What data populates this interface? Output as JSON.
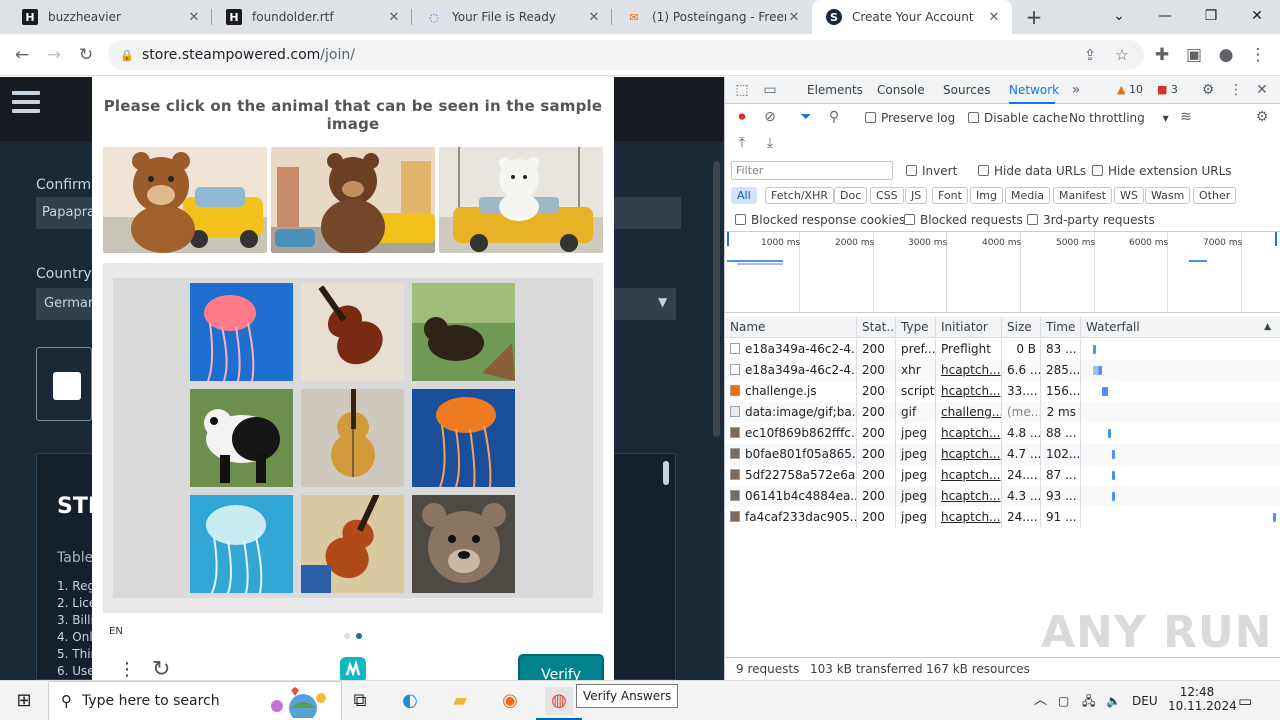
{
  "browser": {
    "tabs": [
      {
        "title": "buzzheavier",
        "icon": "h-logo-icon"
      },
      {
        "title": "foundolder.rtf",
        "icon": "h-logo-icon"
      },
      {
        "title": "Your File is Ready",
        "icon": "loading-icon"
      },
      {
        "title": "(1) Posteingang - Freemail",
        "icon": "mail-icon"
      },
      {
        "title": "Create Your Account",
        "icon": "steam-icon"
      }
    ],
    "url_host": "store.steampowered.com",
    "url_path": "/join/"
  },
  "steam_page": {
    "confirm_label": "Confirm",
    "confirm_value": "Papapra",
    "country_label": "Country",
    "country_value": "German",
    "ssa_heading": "STE",
    "ssa_sub": "Table",
    "ssa_items": [
      "1. Reg",
      "2. Lice",
      "3. Billi",
      "4. Onli",
      "5. Thir",
      "6. Use"
    ]
  },
  "captcha": {
    "prompt": "Please click on the animal that can be seen in the sample image",
    "sample_images": [
      "bear-with-taxi",
      "bear-with-taxi-city",
      "polar-bear-with-taxi"
    ],
    "grid": [
      "jellyfish",
      "violin",
      "bear",
      "panda",
      "violin",
      "jellyfish",
      "jellyfish",
      "violin",
      "bear"
    ],
    "language": "EN",
    "page_dots": 2,
    "active_dot": 1,
    "verify_label": "Verify"
  },
  "devtools": {
    "tabs": [
      "Elements",
      "Console",
      "Sources",
      "Network"
    ],
    "active_tab": "Network",
    "warnings": "10",
    "errors": "3",
    "preserve_log": "Preserve log",
    "disable_cache": "Disable cache",
    "throttling": "No throttling",
    "filter_placeholder": "Filter",
    "invert": "Invert",
    "hide_data_urls": "Hide data URLs",
    "hide_extension_urls": "Hide extension URLs",
    "type_filters": [
      "All",
      "Fetch/XHR",
      "Doc",
      "CSS",
      "JS",
      "Font",
      "Img",
      "Media",
      "Manifest",
      "WS",
      "Wasm",
      "Other"
    ],
    "blocked_cookies": "Blocked response cookies",
    "blocked_requests": "Blocked requests",
    "third_party": "3rd-party requests",
    "timeline_ticks": [
      "1000 ms",
      "2000 ms",
      "3000 ms",
      "4000 ms",
      "5000 ms",
      "6000 ms",
      "7000 ms"
    ],
    "columns": [
      "Name",
      "Stat...",
      "Type",
      "Initiator",
      "Size",
      "Time",
      "Waterfall"
    ],
    "rows": [
      {
        "name": "e18a349a-46c2-4...",
        "status": "200",
        "type": "pref...",
        "initiator": "Preflight",
        "size": "0 B",
        "time": "83 ...",
        "kind": "doc",
        "wf_start": 0.04,
        "wf_len": 0.01
      },
      {
        "name": "e18a349a-46c2-4...",
        "status": "200",
        "type": "xhr",
        "initiator": "hcaptch...",
        "size": "6.6 ...",
        "time": "285...",
        "kind": "doc",
        "wf_start": 0.04,
        "wf_len": 0.05
      },
      {
        "name": "challenge.js",
        "status": "200",
        "type": "script",
        "initiator": "hcaptch...",
        "size": "33....",
        "time": "156...",
        "kind": "js",
        "wf_start": 0.09,
        "wf_len": 0.03
      },
      {
        "name": "data:image/gif;ba...",
        "status": "200",
        "type": "gif",
        "initiator": "challeng...",
        "size": "(me...",
        "time": "2 ms",
        "kind": "data",
        "wf_start": 0,
        "wf_len": 0
      },
      {
        "name": "ec10f869b862fffc...",
        "status": "200",
        "type": "jpeg",
        "initiator": "hcaptch...",
        "size": "4.8 ...",
        "time": "88 ...",
        "kind": "img",
        "wf_start": 0.12,
        "wf_len": 0.01
      },
      {
        "name": "b0fae801f05a865...",
        "status": "200",
        "type": "jpeg",
        "initiator": "hcaptch...",
        "size": "4.7 ...",
        "time": "102...",
        "kind": "img",
        "wf_start": 0.14,
        "wf_len": 0.02
      },
      {
        "name": "5df22758a572e6a...",
        "status": "200",
        "type": "jpeg",
        "initiator": "hcaptch...",
        "size": "24....",
        "time": "87 ...",
        "kind": "img",
        "wf_start": 0.14,
        "wf_len": 0.02
      },
      {
        "name": "06141b4c4884ea...",
        "status": "200",
        "type": "jpeg",
        "initiator": "hcaptch...",
        "size": "4.3 ...",
        "time": "93 ...",
        "kind": "img",
        "wf_start": 0.14,
        "wf_len": 0.02
      },
      {
        "name": "fa4caf233dac905...",
        "status": "200",
        "type": "jpeg",
        "initiator": "hcaptch...",
        "size": "24....",
        "time": "91 ...",
        "kind": "img",
        "wf_start": 0.99,
        "wf_len": 0.01
      }
    ],
    "summary_requests": "9 requests",
    "summary_transferred": "103 kB transferred",
    "summary_resources": "167 kB resources",
    "watermark": "ANY RUN"
  },
  "taskbar": {
    "search_placeholder": "Type here to search",
    "tooltip": "Verify Answers",
    "language": "DEU",
    "time": "12:48",
    "date": "10.11.2024"
  },
  "colors": {
    "steam_bg": "#1b2838",
    "hcaptcha_teal": "#00838f",
    "devtools_accent": "#1a73e8"
  }
}
